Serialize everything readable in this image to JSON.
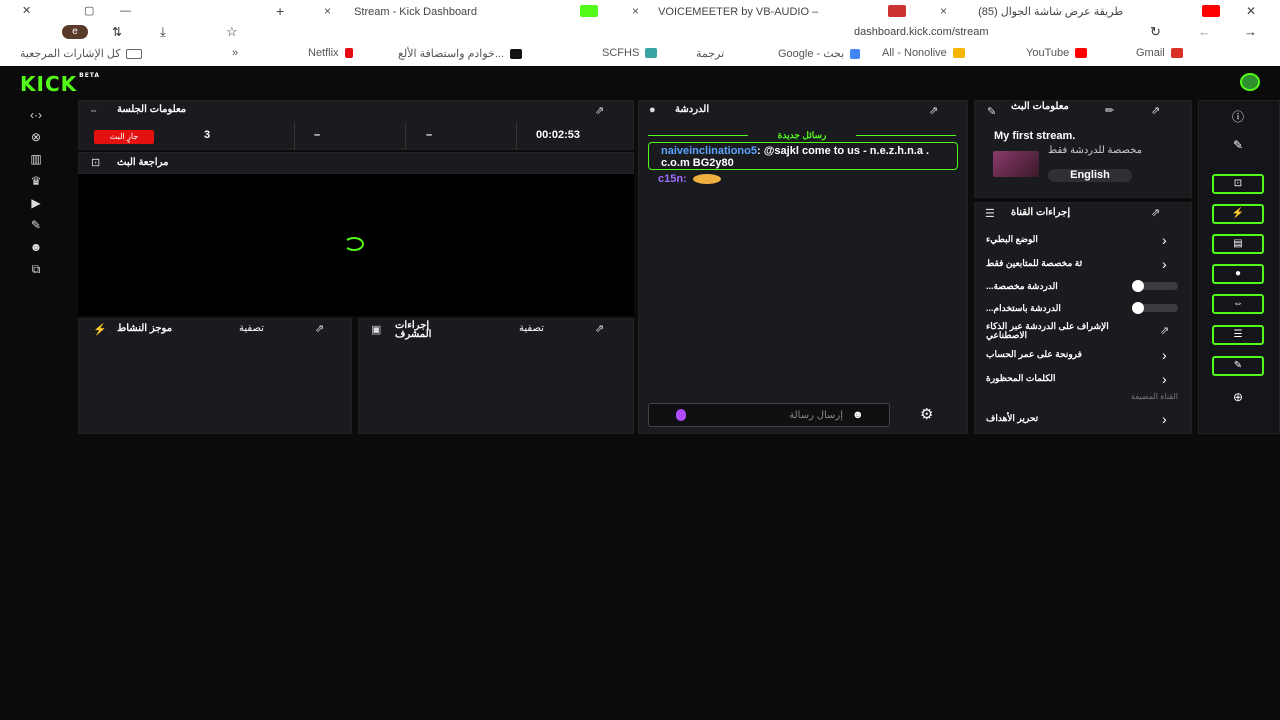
{
  "browser": {
    "tabs": [
      {
        "title": "Stream - Kick Dashboard",
        "icon": "kick-favicon"
      },
      {
        "title": "VOICEMEETER by VB-AUDIO –",
        "icon": "vm-favicon"
      },
      {
        "title": "(85) طريقة عرض شاشة الجوال",
        "icon": "youtube-favicon"
      }
    ],
    "new_tab": "+",
    "close": "×",
    "url": "dashboard.kick.com/stream",
    "profile_initial": "e",
    "bookmarks": [
      {
        "label": "Gmail",
        "color": "#d93025"
      },
      {
        "label": "YouTube",
        "color": "#ff0000"
      },
      {
        "label": "All - Nonolive",
        "color": "#f5b400"
      },
      {
        "label": "Google - بحث",
        "color": "#4285f4"
      },
      {
        "label": "ترجمة",
        "color": "#4285f4"
      },
      {
        "label": "SCFHS",
        "color": "#3aa3a3"
      },
      {
        "label": "خوادم واستضافة الألع...",
        "color": "#111111"
      },
      {
        "label": "Netflix",
        "color": "#e50914"
      },
      {
        "label": "كل الإشارات المرجعية",
        "color": "#888888"
      }
    ],
    "more": "»"
  },
  "app": {
    "logo": "KICK",
    "logo_tag": "BETA",
    "session": {
      "title": "معلومات الجلسة",
      "live_label": "جارٍ البث",
      "viewers": "3",
      "stat2": "–",
      "stat3": "–",
      "uptime": "00:02:53"
    },
    "preview": {
      "title": "مراجعة البث"
    },
    "activity": {
      "title": "موجز النشاط",
      "filter": "تصفية"
    },
    "mod": {
      "title": "إجراءات المشرف",
      "filter": "تصفية"
    },
    "chat": {
      "title": "الدردشة",
      "new_messages": "رسائل جديدة",
      "messages": [
        {
          "user": "naiveinclinationo5",
          "text": "@sajkl come to us - n.e.z.h.n.a . c.o.m BG2y80"
        },
        {
          "user": "c15n",
          "text": ""
        }
      ],
      "input_placeholder": "إرسال رسالة"
    },
    "stream_info": {
      "title": "معلومات البث",
      "stream_title": "My first stream.",
      "category": "مخصصة للدردشة فقط",
      "language": "English"
    },
    "channel_actions": {
      "title": "إجراءات القناة",
      "items": [
        {
          "label": "الوضع البطيء",
          "kind": "chevron"
        },
        {
          "label": "ثة مخصصة للمتابعين فقط",
          "kind": "chevron"
        },
        {
          "label": "...الدردشة مخصصة",
          "kind": "toggle"
        },
        {
          "label": "...الدردشة باستخدام",
          "kind": "toggle"
        },
        {
          "label": "الإشراف على الدردشة عبر الذكاء الاصطناعي",
          "kind": "external"
        },
        {
          "label": "فرونحة على عمر الحساب",
          "kind": "chevron"
        },
        {
          "label": "الكلمات المحظورة",
          "kind": "chevron"
        }
      ],
      "section_heading": "القناة المضيفة",
      "goals": "تحرير الأهداف"
    }
  }
}
